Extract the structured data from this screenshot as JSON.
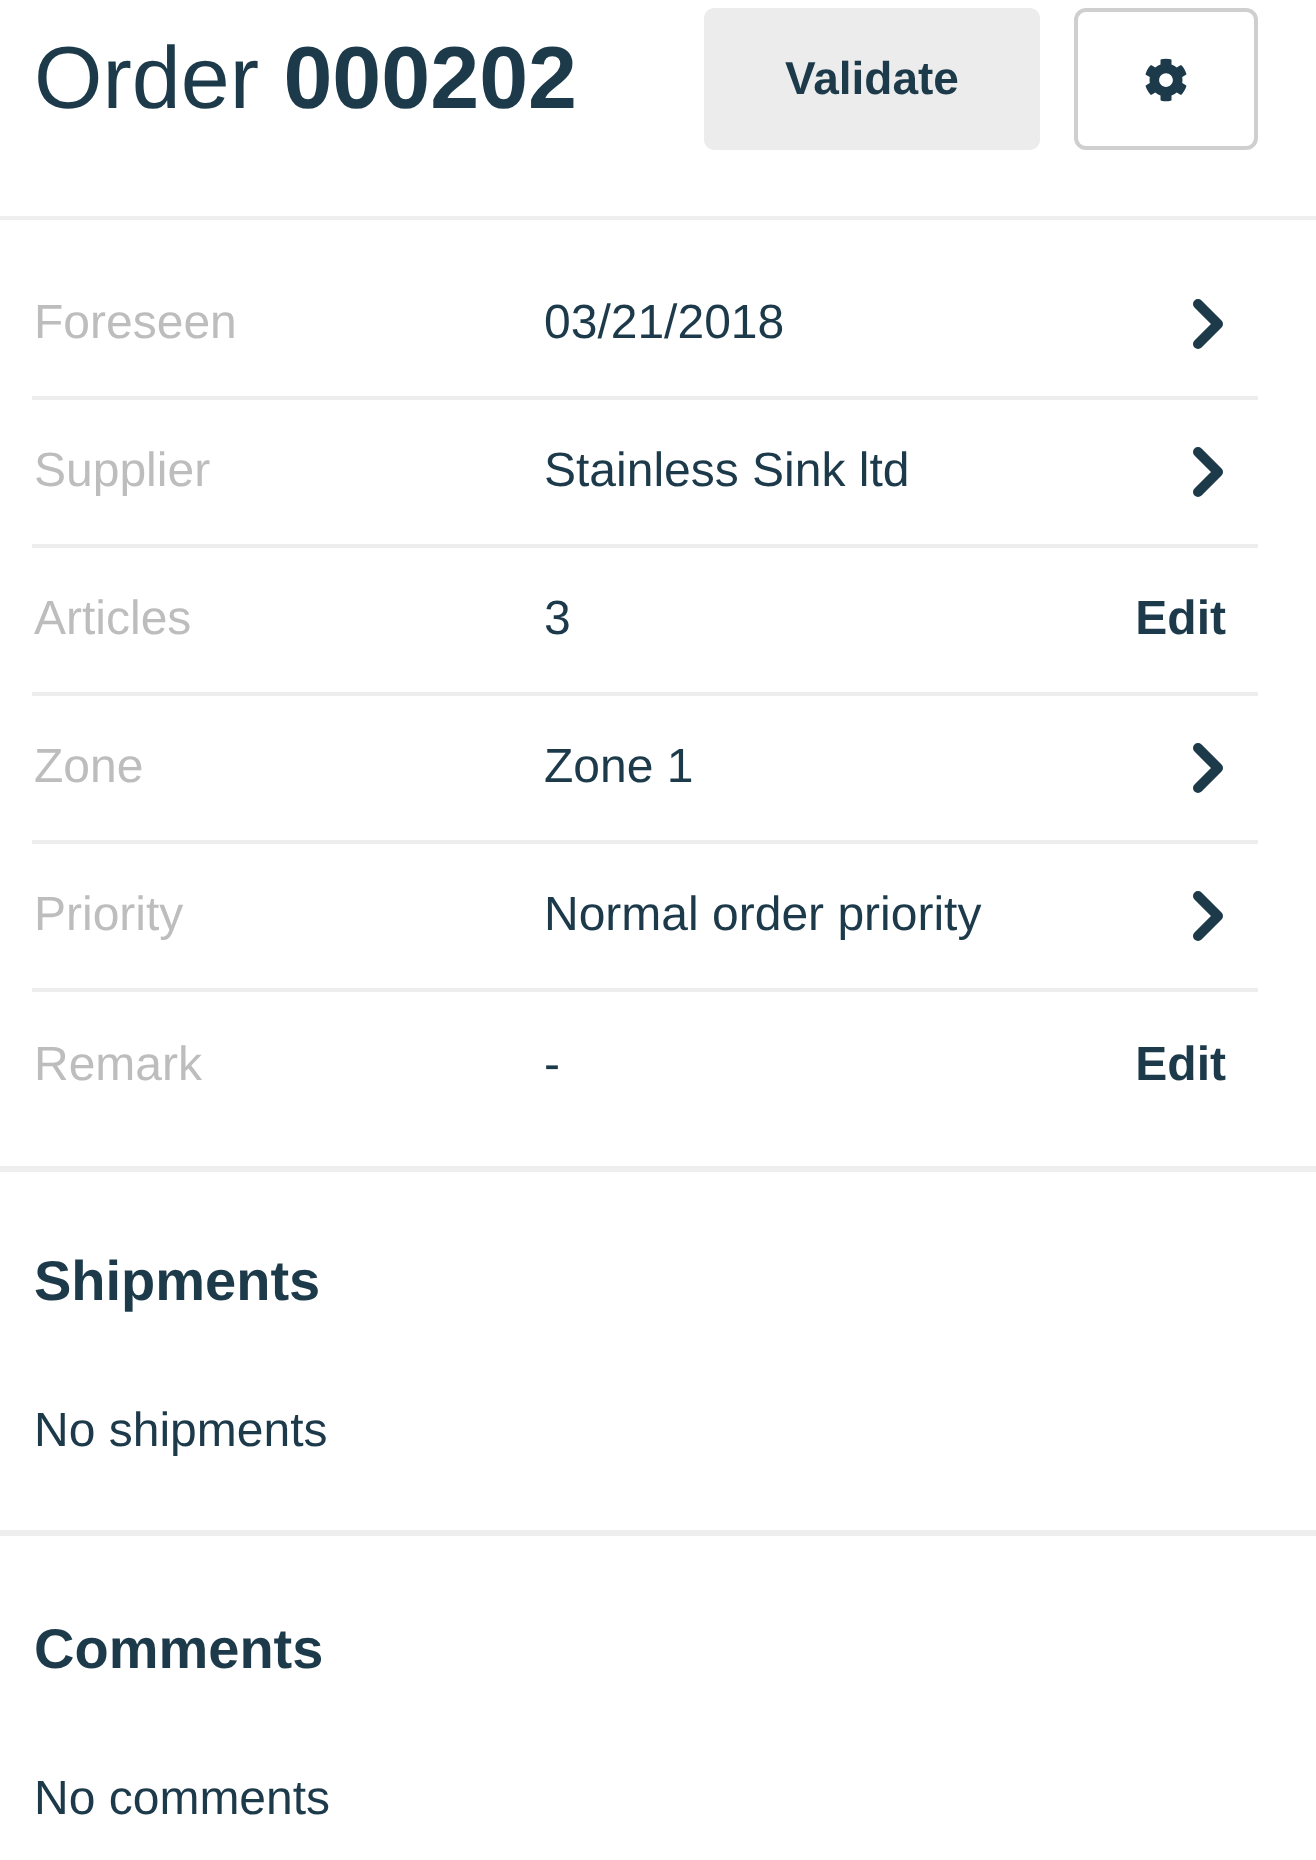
{
  "header": {
    "title": "Order **000202**",
    "validate_button": {
      "label": "Validate"
    }
  },
  "fields": [
    {
      "label": "Foreseen",
      "value": "03/21/2018",
      "kind": "navigate"
    },
    {
      "label": "Supplier",
      "value": "Stainless Sink ltd",
      "kind": "navigate"
    },
    {
      "label": "Articles",
      "value": "3",
      "kind": "editable",
      "action": "Edit"
    },
    {
      "label": "Zone",
      "value": "Zone 1",
      "kind": "navigate"
    },
    {
      "label": "Priority",
      "value": "Normal order priority",
      "kind": "navigate"
    },
    {
      "label": "Remark",
      "value": "-",
      "kind": "editable",
      "action": "Edit"
    }
  ],
  "sections": [
    {
      "title": "Shipments",
      "empty_text": "No shipments"
    },
    {
      "title": "Comments",
      "empty_text": "No comments"
    }
  ]
}
